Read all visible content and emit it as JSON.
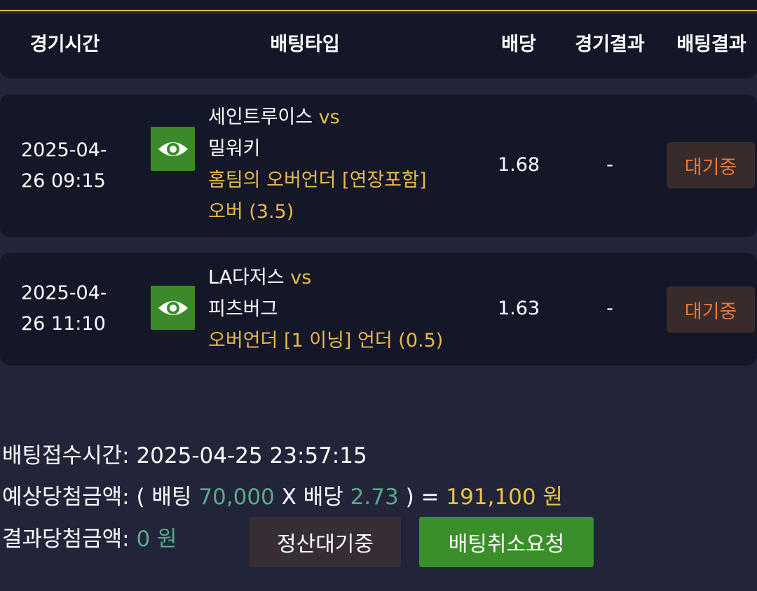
{
  "colors": {
    "background": "#222539",
    "card": "#141728",
    "gold": "#e9b94a",
    "teal": "#5aa98c",
    "badge_text": "#e4793e",
    "green_button": "#3a8f2a"
  },
  "header": {
    "time": "경기시간",
    "bet_type": "배팅타입",
    "odds": "배당",
    "game_result": "경기결과",
    "bet_result": "배팅결과"
  },
  "bets": [
    {
      "time_line1": "2025-04-",
      "time_line2": "26 09:15",
      "icon": "eye-icon",
      "home": "세인트루이스",
      "vs": "vs",
      "away": "밀워키",
      "market": "홈팀의 오버언더 [연장포함]",
      "pick": "오버 (3.5)",
      "odds": "1.68",
      "result": "-",
      "status": "대기중"
    },
    {
      "time_line1": "2025-04-",
      "time_line2": "26 11:10",
      "icon": "eye-icon",
      "home": "LA다저스",
      "vs": "vs",
      "away": "피츠버그",
      "market": "오버언더 [1 이닝] 언더 (0.5)",
      "pick": "",
      "odds": "1.63",
      "result": "-",
      "status": "대기중"
    }
  ],
  "summary": {
    "received_label": "배팅접수시간:",
    "received_value": "2025-04-25 23:57:15",
    "expected_label": "예상당첨금액:",
    "open_paren": "(",
    "bet_word": "배팅",
    "bet_amount": "70,000",
    "times": "X",
    "odds_word": "배당",
    "total_odds": "2.73",
    "close_paren": ") =",
    "expected_amount": "191,100 원",
    "result_label": "결과당첨금액:",
    "result_amount": "0 원"
  },
  "buttons": {
    "settle": "정산대기중",
    "cancel_request": "배팅취소요청"
  }
}
